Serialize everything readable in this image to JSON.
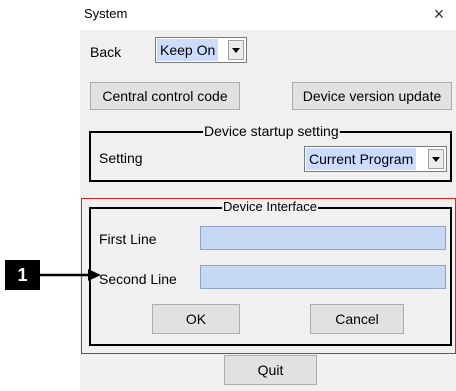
{
  "window": {
    "title": "System",
    "close_glyph": "×"
  },
  "back": {
    "label": "Back",
    "selected": "Keep On"
  },
  "buttons": {
    "central_control": "Central control code",
    "version_update": "Device version update",
    "ok": "OK",
    "cancel": "Cancel",
    "quit": "Quit"
  },
  "startup_group": {
    "title": "Device startup setting",
    "setting_label": "Setting",
    "selected": "Current Program"
  },
  "interface_group": {
    "title": "Device Interface",
    "first_line_label": "First Line",
    "first_line_value": "",
    "second_line_label": "Second Line",
    "second_line_value": ""
  },
  "callout": {
    "number": "1"
  },
  "colors": {
    "dialog_bg": "#f0f0f0",
    "selection_highlight": "#ccdcff",
    "text_field_fill": "#c7d8f5",
    "highlight_frame": "#e2231a"
  }
}
